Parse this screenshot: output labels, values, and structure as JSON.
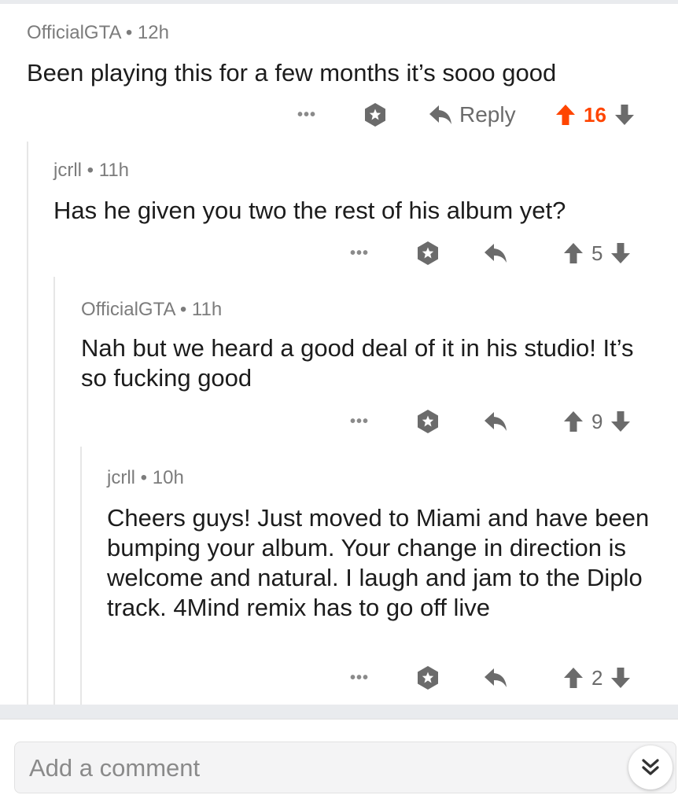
{
  "comments": [
    {
      "author": "OfficialGTA",
      "time": "12h",
      "separator": "•",
      "body": "Been playing this for a few months it’s sooo good",
      "more_label": "•••",
      "reply_label": "Reply",
      "score": "16",
      "upvoted": true
    },
    {
      "author": "jcrll",
      "time": "11h",
      "separator": "•",
      "body": "Has he given you two the rest of his album yet?",
      "more_label": "•••",
      "score": "5",
      "upvoted": false
    },
    {
      "author": "OfficialGTA",
      "time": "11h",
      "separator": "•",
      "body": "Nah but we heard a good deal of it in his studio! It’s so fucking good",
      "more_label": "•••",
      "score": "9",
      "upvoted": false
    },
    {
      "author": "jcrll",
      "time": "10h",
      "separator": "•",
      "body": "Cheers guys! Just moved to Miami and have been bumping your album. Your change in direction is welcome and natural. I laugh and jam to the Diplo track. 4Mind remix has to go off live",
      "more_label": "•••",
      "score": "2",
      "upvoted": false
    }
  ],
  "composer": {
    "placeholder": "Add a comment"
  },
  "icons": {
    "more": "more-dots-icon",
    "save": "star-badge-icon",
    "reply": "reply-arrow-icon",
    "upvote": "arrow-up-icon",
    "downvote": "arrow-down-icon",
    "collapse": "double-chevron-down-icon"
  },
  "colors": {
    "upvote_active": "#ff4500",
    "icon_gray": "#6b6b6b",
    "meta_gray": "#7c7c7c",
    "background": "#ffffff",
    "band": "#e9ebee"
  }
}
